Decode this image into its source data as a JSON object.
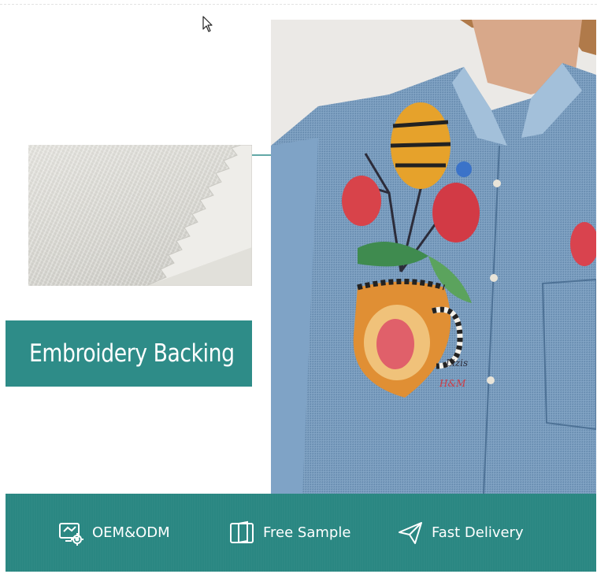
{
  "banner": {
    "title": "Embroidery Backing"
  },
  "features": [
    {
      "label": "OEM&ODM",
      "icon": "oem-settings-icon"
    },
    {
      "label": "Free Sample",
      "icon": "book-icon"
    },
    {
      "label": "Fast Delivery",
      "icon": "paper-plane-icon"
    }
  ],
  "colors": {
    "accent": "#2e8c88",
    "bar": "#2a8782"
  }
}
